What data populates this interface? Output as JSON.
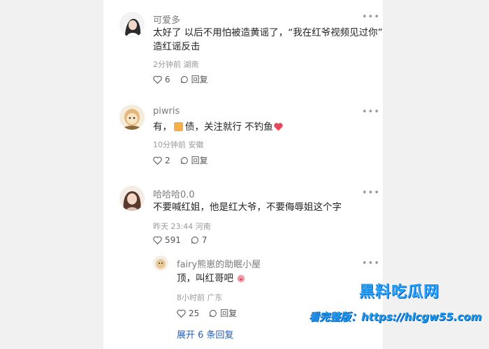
{
  "comments": [
    {
      "username": "可爱多",
      "text_line1": "太好了 以后不用怕被造黄谣了，“我在红爷视频见过你”",
      "text_line2": "造红谣反击",
      "meta": "2分钟前 湖南",
      "likes": "6",
      "reply_label": "回复"
    },
    {
      "username": "piwris",
      "text_before": "有，",
      "text_after": "债，关注就行 不钓鱼",
      "meta": "10分钟前 安徽",
      "likes": "2",
      "reply_label": "回复"
    },
    {
      "username": "哈哈哈0.0",
      "text": "不要喊红姐，他是红大爷，不要侮辱姐这个字",
      "meta": "昨天 23:44 河南",
      "likes": "591",
      "replies": "7"
    }
  ],
  "reply": {
    "username": "fairy熊崽的助眠小屋",
    "text": "顶，叫红哥吧",
    "meta": "8小时前 广东",
    "likes": "25",
    "reply_label": "回复"
  },
  "expand_label": "展开 6 条回复",
  "more_label": "•••",
  "watermark": {
    "brand": "黑料吃瓜网",
    "url_line": "看完整版：https://hlcgw55.com"
  },
  "colors": {
    "link": "#2a5db0",
    "watermark": "#2aa8ff",
    "heart_emoji": "#e8485b"
  }
}
